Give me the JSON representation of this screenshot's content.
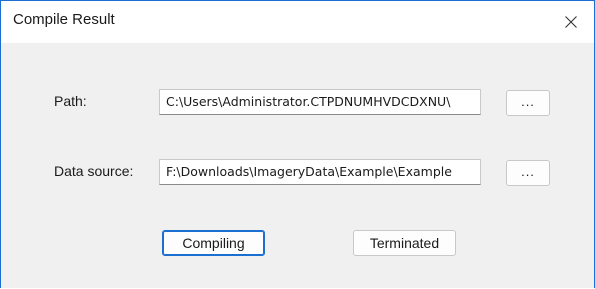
{
  "window": {
    "title": "Compile Result"
  },
  "form": {
    "path_label": "Path:",
    "path_value": "C:\\Users\\Administrator.CTPDNUMHVDCDXNU\\",
    "data_source_label": "Data source:",
    "data_source_value": "F:\\Downloads\\ImageryData\\Example\\Example",
    "browse_label": "..."
  },
  "actions": {
    "compiling_label": "Compiling",
    "terminated_label": "Terminated"
  },
  "colors": {
    "accent": "#1a6fd0",
    "background": "#f0f0f0"
  }
}
